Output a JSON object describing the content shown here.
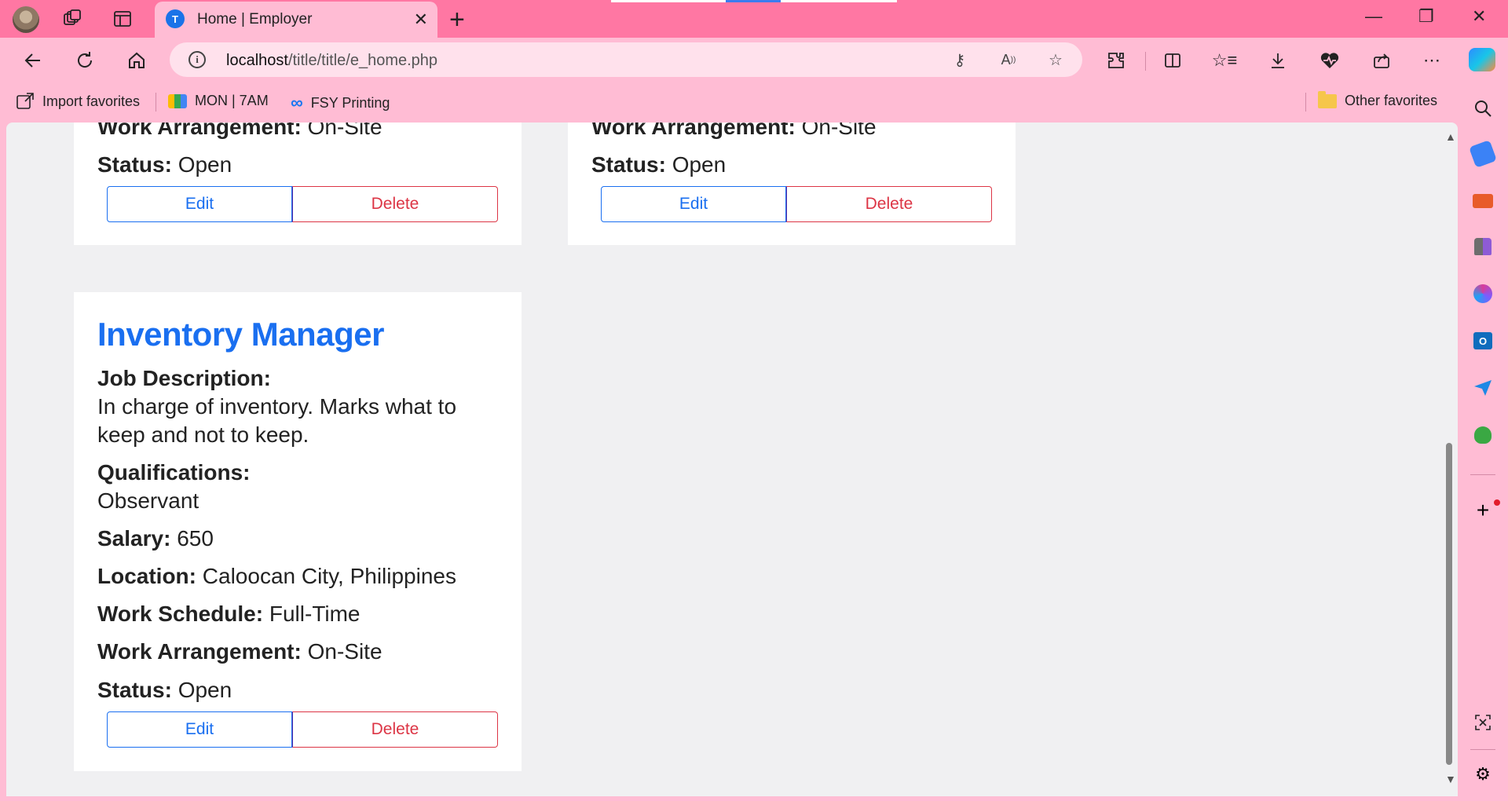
{
  "browser": {
    "tab_title": "Home | Employer",
    "tab_favicon": "T",
    "url_host": "localhost",
    "url_path": "/title/title/e_home.php",
    "favorites": [
      {
        "label": "Import favorites",
        "icon": "import-favorites-icon"
      },
      {
        "label": "MON | 7AM",
        "icon": "google-meet-icon"
      },
      {
        "label": "FSY Printing",
        "icon": "meta-icon"
      }
    ],
    "other_favorites": "Other favorites"
  },
  "page": {
    "field_labels": {
      "description": "Job Description:",
      "qualifications": "Qualifications:",
      "salary": "Salary:",
      "location": "Location:",
      "schedule": "Work Schedule:",
      "arrangement": "Work Arrangement:",
      "status": "Status:"
    },
    "buttons": {
      "edit": "Edit",
      "delete": "Delete"
    },
    "jobs": [
      {
        "arrangement": "On-Site",
        "status": "Open"
      },
      {
        "arrangement": "On-Site",
        "status": "Open"
      },
      {
        "title": "Inventory Manager",
        "description_line1": "In charge of inventory. Marks what to",
        "description_line2": "keep and not to keep.",
        "qualifications": "Observant",
        "salary": "650",
        "location": "Caloocan City, Philippines",
        "schedule": "Full-Time",
        "arrangement": "On-Site",
        "status": "Open"
      }
    ]
  },
  "colors": {
    "browser_chrome": "#ffbcd4",
    "title_bar": "#ff77a3",
    "page_background": "#f0f0f2",
    "link_blue": "#1a6ff0",
    "danger_red": "#dc3545"
  }
}
